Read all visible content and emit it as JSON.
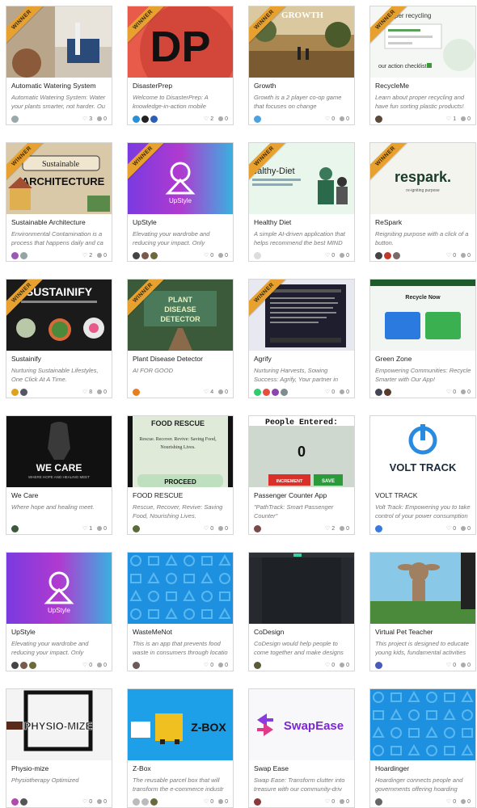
{
  "ribbon_text": "WINNER",
  "cards": [
    {
      "title": "Automatic Watering System",
      "tagline": "Automatic Watering System: Water your plants smarter, not harder. Ou",
      "likes": "3",
      "comments": "0",
      "winner": true,
      "thumb": "photo-board",
      "avatars": [
        "#9aa"
      ]
    },
    {
      "title": "DisasterPrep",
      "tagline": "Welcome to DisasterPrep: A knowledge-in-action mobile",
      "likes": "2",
      "comments": "0",
      "winner": true,
      "thumb": "dp",
      "avatars": [
        "#2a8fd6",
        "#222",
        "#2a5fb8"
      ]
    },
    {
      "title": "Growth",
      "tagline": "Growth is a 2 player co-op game that focuses on change",
      "likes": "0",
      "comments": "0",
      "winner": true,
      "thumb": "growth",
      "avatars": [
        "#4aa3e0"
      ]
    },
    {
      "title": "RecycleMe",
      "tagline": "Learn about proper recycling and have fun sorting plastic products!",
      "likes": "1",
      "comments": "0",
      "winner": true,
      "thumb": "recycle",
      "avatars": [
        "#5a4a3a"
      ]
    },
    {
      "title": "Sustainable Architecture",
      "tagline": "Environmental Contamination is a process that happens daily and ca",
      "likes": "2",
      "comments": "0",
      "winner": true,
      "thumb": "arch",
      "avatars": [
        "#9b59b6",
        "#95a5a6"
      ]
    },
    {
      "title": "UpStyle",
      "tagline": "Elevating your wardrobe and reducing your impact. Only",
      "likes": "0",
      "comments": "0",
      "winner": true,
      "thumb": "upstyle",
      "avatars": [
        "#444",
        "#7a5a4a",
        "#6a6a3a"
      ]
    },
    {
      "title": "Healthy Diet",
      "tagline": "A simple AI-driven application that helps recommend the best MIND",
      "likes": "0",
      "comments": "0",
      "winner": true,
      "thumb": "diet",
      "avatars": [
        "#ddd"
      ]
    },
    {
      "title": "ReSpark",
      "tagline": "Reigniting purpose with a click of a button.",
      "likes": "0",
      "comments": "0",
      "winner": true,
      "thumb": "respark",
      "avatars": [
        "#444",
        "#c0392b",
        "#7a6a6a"
      ]
    },
    {
      "title": "Sustainify",
      "tagline": "Nurturing Sustainable Lifestyles, One Click At A Time.",
      "likes": "8",
      "comments": "0",
      "winner": true,
      "thumb": "sustainify",
      "avatars": [
        "#e0a020",
        "#556"
      ]
    },
    {
      "title": "Plant Disease Detector",
      "tagline": "AI FOR GOOD",
      "likes": "4",
      "comments": "0",
      "winner": true,
      "thumb": "plant",
      "avatars": [
        "#e67e22"
      ]
    },
    {
      "title": "Agrify",
      "tagline": "Nurturing Harvests, Sowing Success: Agrify, Your partner in Precise Cro",
      "likes": "0",
      "comments": "0",
      "winner": true,
      "thumb": "agrify",
      "avatars": [
        "#2ecc71",
        "#e74c3c",
        "#8e44ad",
        "#7f8c8d"
      ]
    },
    {
      "title": "Green Zone",
      "tagline": "Empowering Communities: Recycle Smarter with Our App!",
      "likes": "0",
      "comments": "0",
      "winner": false,
      "thumb": "green",
      "avatars": [
        "#445",
        "#5a3a2a"
      ]
    },
    {
      "title": "We Care",
      "tagline": "Where hope and healing meet.",
      "likes": "1",
      "comments": "0",
      "winner": false,
      "thumb": "wecare",
      "avatars": [
        "#3a5a3a"
      ]
    },
    {
      "title": "FOOD RESCUE",
      "tagline": "Rescue, Recover, Revive: Saving Food, Nourishing Lives.",
      "likes": "0",
      "comments": "0",
      "winner": false,
      "thumb": "food",
      "avatars": [
        "#5a6a3a"
      ]
    },
    {
      "title": "Passenger Counter App",
      "tagline": "\"PathTrack: Smart Passenger Counter\"",
      "likes": "2",
      "comments": "0",
      "winner": false,
      "thumb": "passenger",
      "avatars": [
        "#7a4a4a"
      ]
    },
    {
      "title": "VOLT TRACK",
      "tagline": "Volt Track: Empowering you to take control of your power consumption",
      "likes": "0",
      "comments": "0",
      "winner": false,
      "thumb": "volt",
      "avatars": [
        "#3a7ae0"
      ]
    },
    {
      "title": "UpStyle",
      "tagline": "Elevating your wardrobe and reducing your impact. Only",
      "likes": "0",
      "comments": "0",
      "winner": false,
      "thumb": "upstyle",
      "avatars": [
        "#444",
        "#7a5a4a",
        "#6a6a3a"
      ]
    },
    {
      "title": "WasteMeNot",
      "tagline": "This is an app that prevents food waste in consumers through locatio",
      "likes": "0",
      "comments": "0",
      "winner": false,
      "thumb": "pattern",
      "avatars": [
        "#6a5a5a"
      ]
    },
    {
      "title": "CoDesign",
      "tagline": "CoDesign would help people to come together and make designs for",
      "likes": "0",
      "comments": "0",
      "winner": false,
      "thumb": "codesign",
      "avatars": [
        "#5a5a3a"
      ]
    },
    {
      "title": "Virtual Pet Teacher",
      "tagline": "This project is designed to educate young kids, fundamental activities",
      "likes": "0",
      "comments": "0",
      "winner": false,
      "thumb": "pet",
      "avatars": [
        "#4a5ab8"
      ]
    },
    {
      "title": "Physio-mize",
      "tagline": "Physiotherapy Optimized",
      "likes": "0",
      "comments": "0",
      "winner": false,
      "thumb": "physio",
      "avatars": [
        "#b04ab0",
        "#555"
      ]
    },
    {
      "title": "Z-Box",
      "tagline": "The reusable parcel box that will transform the e-commerce industr",
      "likes": "0",
      "comments": "0",
      "winner": false,
      "thumb": "zbox",
      "avatars": [
        "#bbb",
        "#bbb",
        "#6a6a3a"
      ]
    },
    {
      "title": "Swap Ease",
      "tagline": "Swap Ease: Transform clutter into treasure with our community-driv",
      "likes": "0",
      "comments": "0",
      "winner": false,
      "thumb": "swap",
      "avatars": [
        "#8a3a3a"
      ]
    },
    {
      "title": "Hoardinger",
      "tagline": "Hoardinger connects people and governments offering hoarding",
      "likes": "0",
      "comments": "0",
      "winner": false,
      "thumb": "pattern",
      "avatars": [
        "#666"
      ]
    }
  ],
  "thumb_text": {
    "dp": "DP",
    "growth": "GROWTH",
    "recycle_head": "per recycling",
    "recycle_check": "our action checklist",
    "arch_top": "Sustainable",
    "arch_bottom": "ARCHITECTURE",
    "upstyle": "UpStyle",
    "diet": "ealthy-Diet",
    "respark": "respark.",
    "respark_sub": "re-igniting purpose",
    "sustainify": "SUSTAINIFY",
    "plant": "PLANT DISEASE DETECTOR",
    "green_head": "Recycle Now",
    "wecare": "WE CARE",
    "wecare_sub": "WHERE HOPE AND HEALING MEET",
    "food_head": "FOOD RESCUE",
    "food_body": "Rescue. Recover. Revive: Saving Food, Nourishing Lives.",
    "food_btn": "PROCEED",
    "passenger_head": "People Entered:",
    "passenger_count": "0",
    "passenger_inc": "INCREMENT",
    "passenger_save": "SAVE",
    "volt": "VOLT TRACK",
    "physio": "PHYSIO-MIZE",
    "zbox": "Z-BOX",
    "swap": "SwapEase"
  }
}
